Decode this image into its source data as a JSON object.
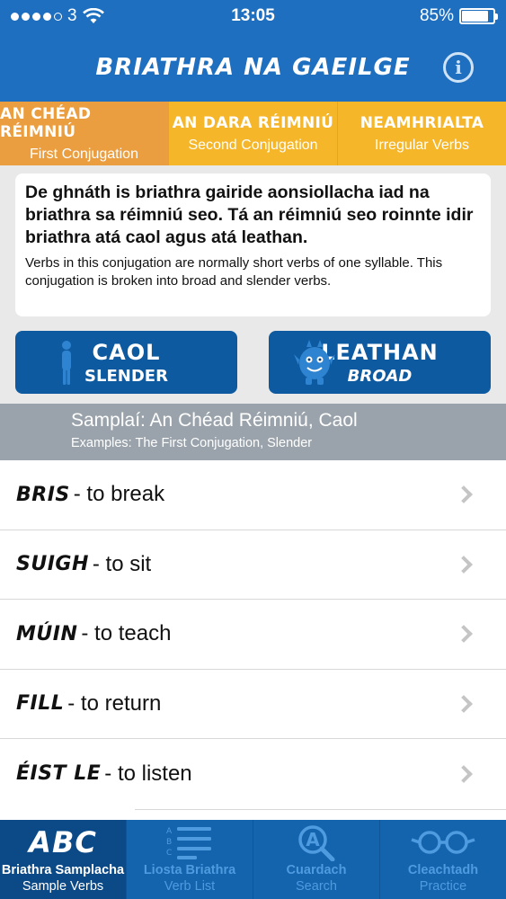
{
  "status": {
    "carrier": "3",
    "time": "13:05",
    "battery": "85%",
    "battery_level": 0.85
  },
  "header": {
    "title": "BRIATHRA NA GAEILGE",
    "info_glyph": "i"
  },
  "tabs": [
    {
      "title": "AN CHÉAD RÉIMNIÚ",
      "subtitle": "First Conjugation",
      "active": true
    },
    {
      "title": "AN DARA RÉIMNIÚ",
      "subtitle": "Second Conjugation",
      "active": false
    },
    {
      "title": "NEAMHRIALTA",
      "subtitle": "Irregular Verbs",
      "active": false
    }
  ],
  "description": {
    "irish": "De ghnáth is briathra gairide aonsiollacha iad na briathra sa réimniú seo. Tá an réimniú seo roinnte idir briathra atá caol agus atá leathan.",
    "english": "Verbs in this conjugation are normally short verbs of one syllable. This conjugation is broken into broad and slender verbs."
  },
  "buttons": {
    "caol": {
      "main": "CAOL",
      "sub": "SLENDER",
      "icon": "slender-person-icon"
    },
    "leathan": {
      "main": "LEATHAN",
      "sub": "BROAD",
      "icon": "broad-monster-icon"
    }
  },
  "section": {
    "title": "Samplaí: An Chéad Réimniú, Caol",
    "subtitle": "Examples: The First Conjugation, Slender"
  },
  "verbs": [
    {
      "name": "BRIS",
      "meaning": "- to break"
    },
    {
      "name": "SUIGH",
      "meaning": "- to sit"
    },
    {
      "name": "MÚIN",
      "meaning": "- to teach"
    },
    {
      "name": "FILL",
      "meaning": "- to return"
    },
    {
      "name": "ÉIST  LE",
      "meaning": " - to listen"
    }
  ],
  "tab_bar": [
    {
      "icon_text": "ABC",
      "label": "Briathra Samplacha",
      "sub": "Sample Verbs",
      "active": true
    },
    {
      "icon_text": "ABC",
      "label": "Liosta Briathra",
      "sub": "Verb List",
      "active": false
    },
    {
      "icon_text": "A",
      "label": "Cuardach",
      "sub": "Search",
      "active": false
    },
    {
      "icon_text": "",
      "label": "Cleachtadh",
      "sub": "Practice",
      "active": false
    }
  ],
  "colors": {
    "primary": "#1e6fc0",
    "accent": "#f5b62a",
    "active_tab": "#eb9e3f",
    "button": "#0d5aa0",
    "section": "#9aa3ab",
    "tabbar": "#1363ad"
  }
}
